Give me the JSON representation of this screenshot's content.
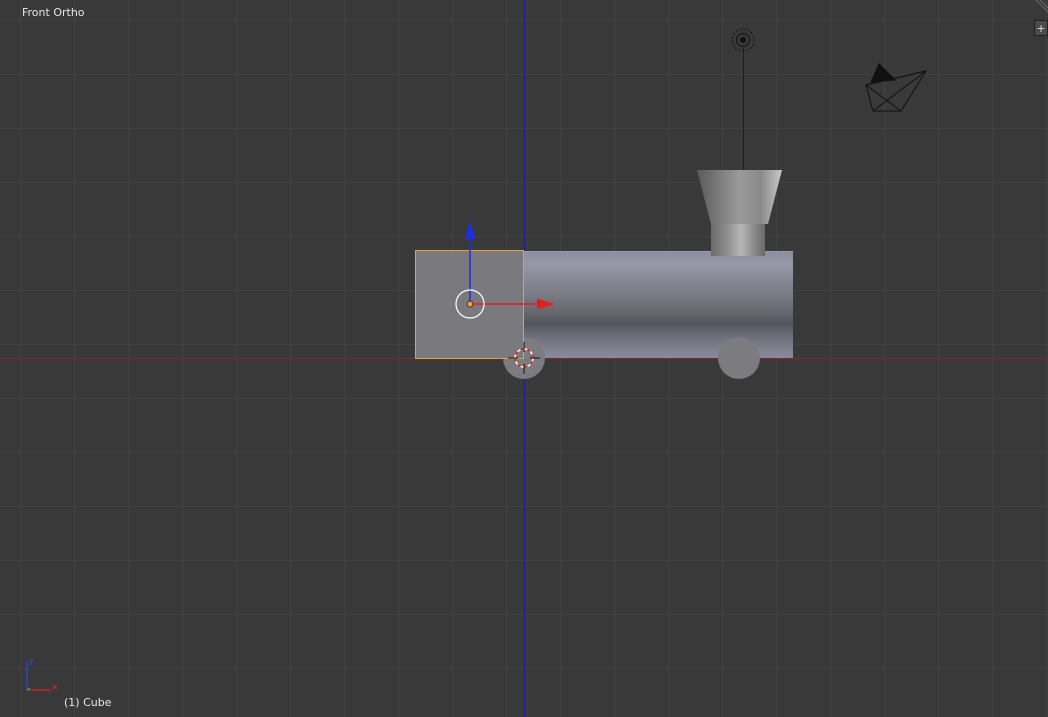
{
  "viewport": {
    "view_label": "Front Ortho",
    "object_label": "(1) Cube",
    "widget_icon": "plus-icon",
    "widget_glyph": "+"
  },
  "colors": {
    "background": "#393939",
    "selection_outline": "#f0a030",
    "axis_x": "#b02020",
    "axis_z": "#1a1aa0",
    "gizmo_x": "#e02020",
    "gizmo_z": "#1a30e0",
    "gizmo_y": "#30c030",
    "mesh_light": "#8a8a96",
    "mesh_dark": "#55555c"
  },
  "scene_objects": [
    {
      "name": "Cube",
      "selected": true
    },
    {
      "name": "train-body",
      "selected": false
    },
    {
      "name": "chimney",
      "selected": false
    },
    {
      "name": "wheel-front",
      "selected": false
    },
    {
      "name": "wheel-rear",
      "selected": false
    },
    {
      "name": "lamp",
      "selected": false
    },
    {
      "name": "camera",
      "selected": false
    },
    {
      "name": "3d-cursor",
      "selected": false
    }
  ]
}
